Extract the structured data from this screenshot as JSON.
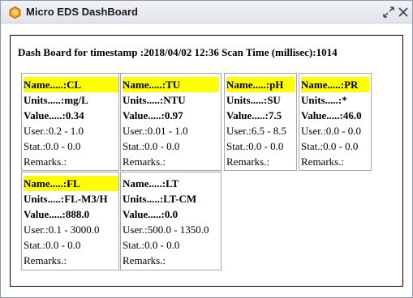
{
  "window": {
    "title": "Micro EDS DashBoard",
    "restore_icon": "restore-arrows-icon",
    "close_icon": "close-x-icon"
  },
  "dashboard": {
    "heading": "Dash Board for timestamp :2018/04/02 12:36 Scan Time (millisec):1014",
    "cards": [
      {
        "name": "Name.....:CL",
        "units": "Units.....:mg/L",
        "value": "Value.....:0.34",
        "user": "User.:0.2 - 1.0",
        "stat": "Stat.:0.0 - 0.0",
        "remarks": "Remarks.:",
        "highlight": "#ffff00"
      },
      {
        "name": "Name.....:TU",
        "units": "Units.....:NTU",
        "value": "Value.....:0.97",
        "user": "User.:0.01 - 1.0",
        "stat": "Stat.:0.0 - 0.0",
        "remarks": "Remarks.:",
        "highlight": "#ffff00"
      },
      {
        "name": "Name.....:pH",
        "units": "Units.....:SU",
        "value": "Value.....:7.5",
        "user": "User.:6.5 - 8.5",
        "stat": "Stat.:0.0 - 0.0",
        "remarks": "Remarks.:",
        "highlight": "#ffff00"
      },
      {
        "name": "Name.....:PR",
        "units": "Units.....:*",
        "value": "Value.....:46.0",
        "user": "User.:0.0 - 0.0",
        "stat": "Stat.:0.0 - 0.0",
        "remarks": "Remarks.:",
        "highlight": "#ffff00"
      },
      {
        "name": "Name.....:FL",
        "units": "Units.....:FL-M3/H",
        "value": "Value.....:888.0",
        "user": "User.:0.1 - 3000.0",
        "stat": "Stat.:0.0 - 0.0",
        "remarks": "Remarks.:",
        "highlight": "#ffff00"
      },
      {
        "name": "Name.....:LT",
        "units": "Units.....:LT-CM",
        "value": "Value.....:0.0",
        "user": "User.:500.0 - 1350.0",
        "stat": "Stat.:0.0 - 0.0",
        "remarks": "Remarks.:",
        "highlight": "none"
      }
    ]
  }
}
